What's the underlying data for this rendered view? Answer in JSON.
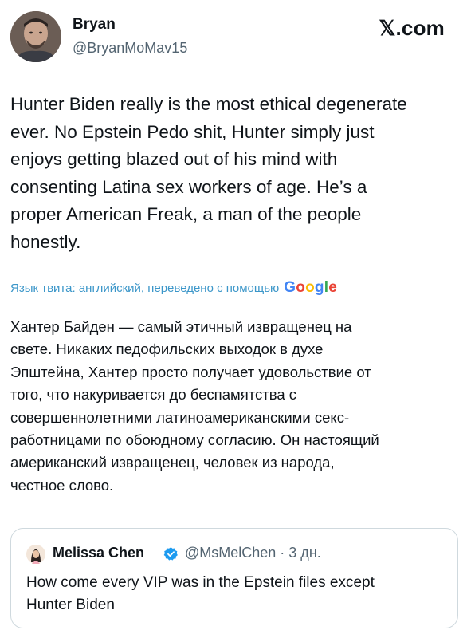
{
  "author": {
    "name": "Bryan",
    "handle": "@BryanMoMav15",
    "avatar_icon": "user-avatar"
  },
  "brand": "𝕏.com",
  "tweet": {
    "text": "Hunter Biden really is the most ethical degenerate\never. No Epstein Pedo shit, Hunter simply just\nenjoys getting blazed out of his mind with\nconsenting Latina sex workers of age. He’s a\nproper American Freak, a man of the people\nhonestly."
  },
  "translation_notice": {
    "label": "Язык твита: английский, переведено с помощью",
    "provider": [
      "G",
      "o",
      "o",
      "g",
      "l",
      "e"
    ],
    "provider_colors": [
      "#4285f4",
      "#ea4335",
      "#fbbc05",
      "#4285f4",
      "#34a853",
      "#ea4335"
    ]
  },
  "translation": {
    "text": "Хантер Байден — самый этичный извращенец на\nсвете. Никаких педофильских выходок в духе\nЭпштейна, Хантер просто получает удовольствие от\nтого, что накуривается до беспамятства с\nсовершеннолетними латиноамериканскими секс-\nработницами по обоюдному согласию. Он настоящий\nамериканский извращенец, человек из народа,\nчестное слово."
  },
  "quoted_tweet": {
    "name": "Melissa Chen",
    "verified_icon": "verified-badge-icon",
    "handle_time": "@MsMelChen · 3 дн.",
    "text": "How come every VIP was in the Epstein files except\nHunter Biden"
  }
}
